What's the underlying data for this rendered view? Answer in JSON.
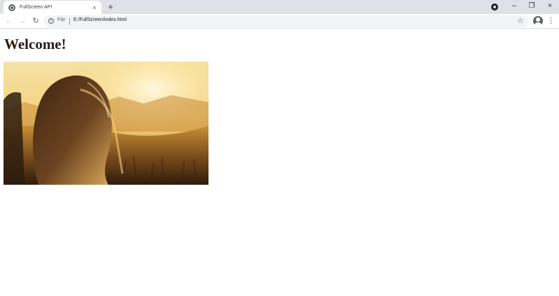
{
  "browser": {
    "tab": {
      "favicon": "globe-icon",
      "title": "FullScreen API",
      "close_glyph": "×"
    },
    "new_tab_glyph": "+",
    "window_controls": {
      "minimize_glyph": "–",
      "restore_glyph": "❐",
      "close_glyph": "×"
    },
    "toolbar": {
      "back_glyph": "←",
      "forward_glyph": "→",
      "reload_glyph": "↻",
      "scheme_label": "File",
      "url": "E:/FullScreen/index.html",
      "bookmark_glyph": "☆",
      "menu_glyph": "⋮"
    }
  },
  "page": {
    "heading": "Welcome!",
    "image": {
      "subject": "sunset-field-girl-photo"
    }
  },
  "colors": {
    "chrome_bg": "#dee1e6",
    "heading_color": "#2b1b14",
    "photo_sky": "#f6e3a8",
    "photo_sun": "#fff6d8",
    "photo_field": "#c98a2e",
    "photo_hair": "#4a2d17"
  }
}
